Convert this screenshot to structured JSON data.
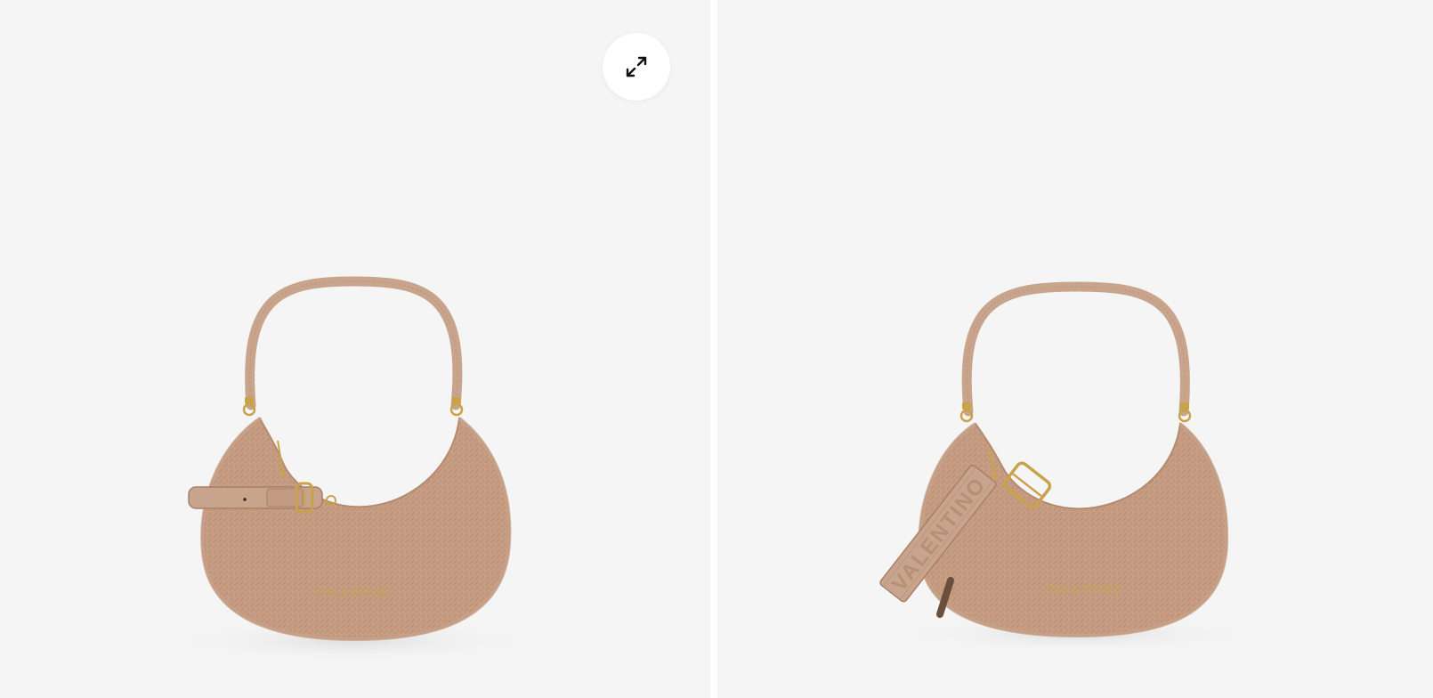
{
  "gallery": {
    "background_color": "#f5f5f5",
    "images": [
      {
        "brand_text": "VALENTINO",
        "bag_color": "#c49a80",
        "strap_color": "#c8a48c",
        "hardware_color": "#c9a24a"
      },
      {
        "brand_text": "VALENTINO",
        "strap_text": "VALENTINO",
        "bag_color": "#c49a80",
        "strap_color": "#c8a48c",
        "hardware_color": "#c9a24a"
      }
    ],
    "expand_button": {
      "icon": "expand-arrows-icon",
      "background_color": "#ffffff"
    }
  }
}
